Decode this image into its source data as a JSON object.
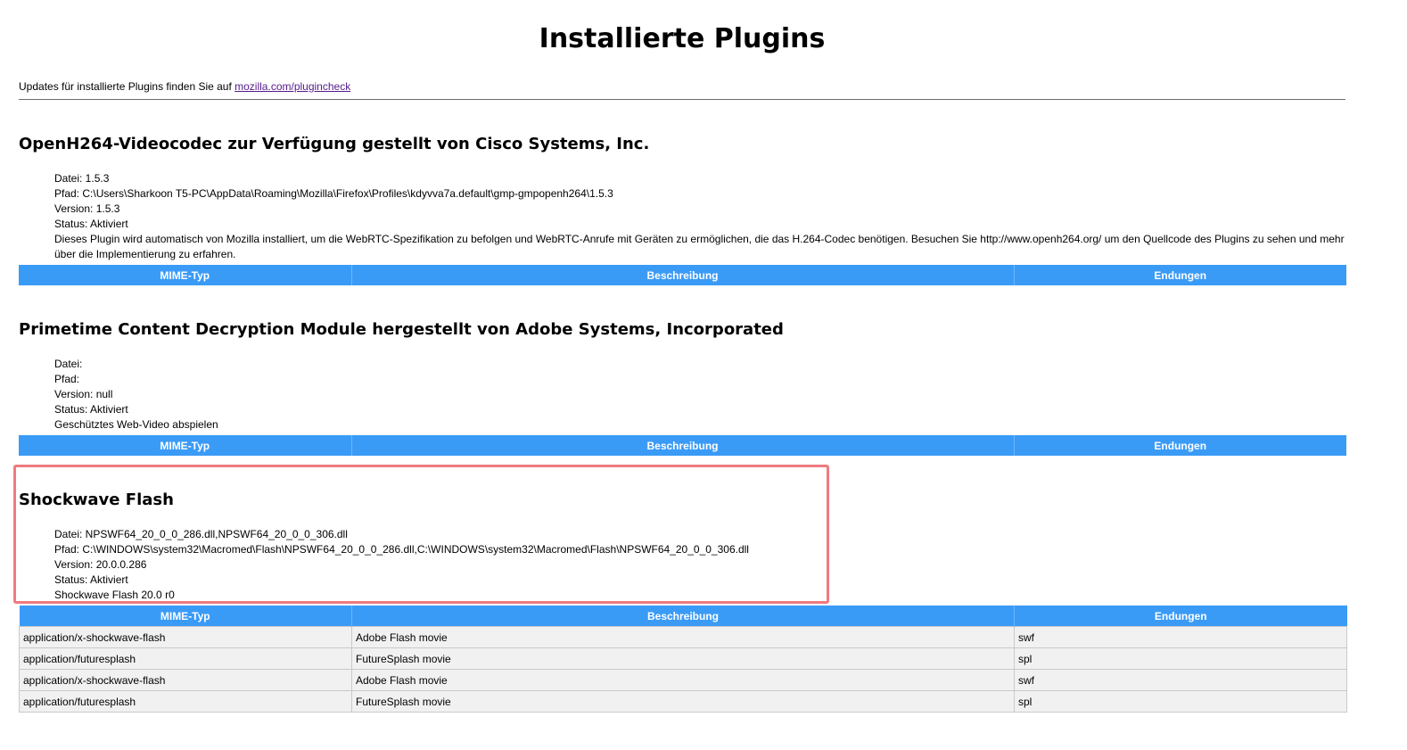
{
  "page": {
    "title": "Installierte Plugins",
    "updates_text": "Updates für installierte Plugins finden Sie auf ",
    "updates_link": "mozilla.com/plugincheck"
  },
  "table_headers": {
    "mime": "MIME-Typ",
    "description": "Beschreibung",
    "extensions": "Endungen"
  },
  "plugins": [
    {
      "title": "OpenH264-Videocodec zur Verfügung gestellt von Cisco Systems, Inc.",
      "file": "Datei: 1.5.3",
      "path": "Pfad: C:\\Users\\Sharkoon T5-PC\\AppData\\Roaming\\Mozilla\\Firefox\\Profiles\\kdyvva7a.default\\gmp-gmpopenh264\\1.5.3",
      "version": "Version: 1.5.3",
      "status": "Status: Aktiviert",
      "description": "Dieses Plugin wird automatisch von Mozilla installiert, um die WebRTC-Spezifikation zu befolgen und WebRTC-Anrufe mit Geräten zu ermöglichen, die das H.264-Codec benötigen. Besuchen Sie http://www.openh264.org/ um den Quellcode des Plugins zu sehen und mehr über die Implementierung zu erfahren."
    },
    {
      "title": "Primetime Content Decryption Module hergestellt von Adobe Systems, Incorporated",
      "file": "Datei:",
      "path": "Pfad:",
      "version": "Version: null",
      "status": "Status: Aktiviert",
      "description": "Geschütztes Web-Video abspielen"
    },
    {
      "title": "Shockwave Flash",
      "file": "Datei: NPSWF64_20_0_0_286.dll,NPSWF64_20_0_0_306.dll",
      "path": "Pfad: C:\\WINDOWS\\system32\\Macromed\\Flash\\NPSWF64_20_0_0_286.dll,C:\\WINDOWS\\system32\\Macromed\\Flash\\NPSWF64_20_0_0_306.dll",
      "version": "Version: 20.0.0.286",
      "status": "Status: Aktiviert",
      "description": "Shockwave Flash 20.0 r0",
      "mime_rows": [
        {
          "mime": "application/x-shockwave-flash",
          "description": "Adobe Flash movie",
          "ext": "swf"
        },
        {
          "mime": "application/futuresplash",
          "description": "FutureSplash movie",
          "ext": "spl"
        },
        {
          "mime": "application/x-shockwave-flash",
          "description": "Adobe Flash movie",
          "ext": "swf"
        },
        {
          "mime": "application/futuresplash",
          "description": "FutureSplash movie",
          "ext": "spl"
        }
      ]
    }
  ],
  "colors": {
    "header_blue": "#3a9bf7",
    "highlight": "#ef7a7f",
    "link": "#551a8b"
  }
}
